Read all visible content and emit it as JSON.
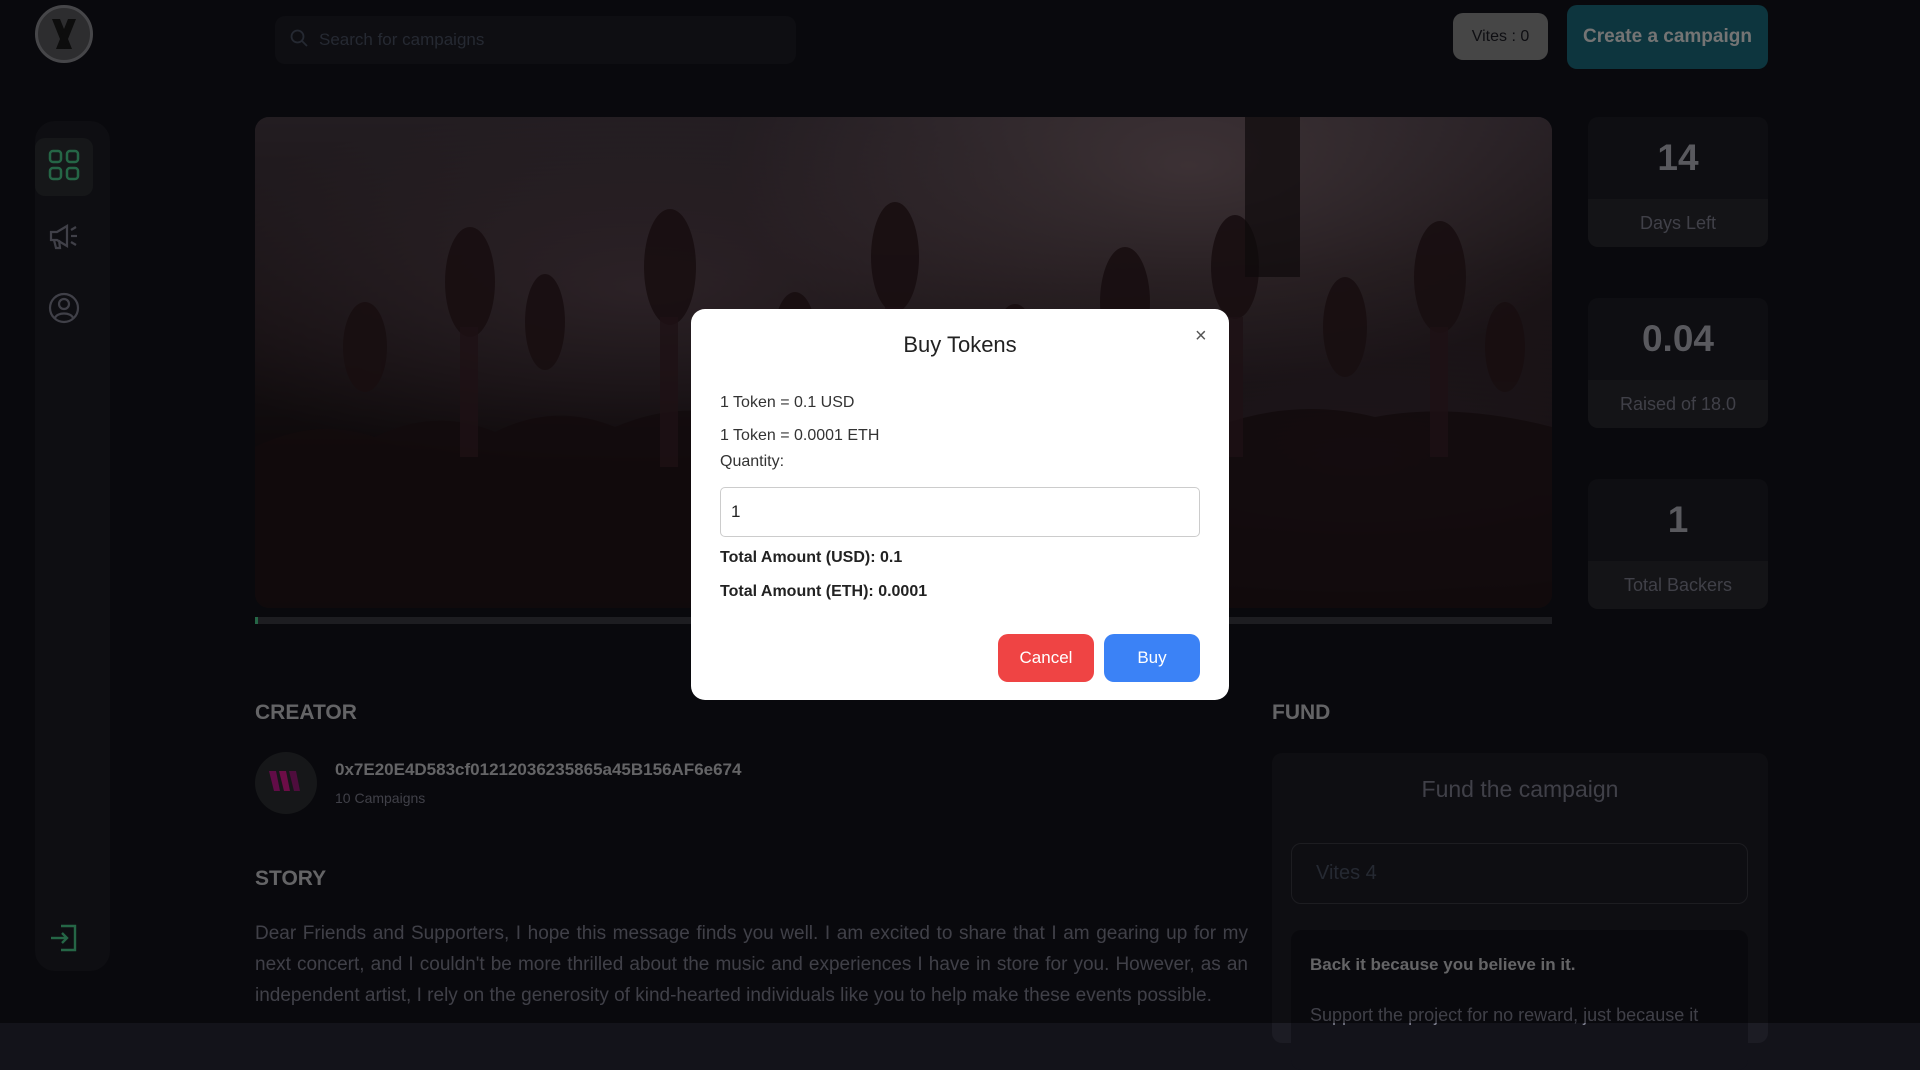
{
  "header": {
    "search_placeholder": "Search for campaigns",
    "vites_label": "Vites : 0",
    "create_label": "Create a campaign"
  },
  "campaign": {
    "progress_fraction": 0.002
  },
  "stats": [
    {
      "value": "14",
      "label": "Days Left"
    },
    {
      "value": "0.04",
      "label": "Raised of 18.0"
    },
    {
      "value": "1",
      "label": "Total Backers"
    }
  ],
  "creator": {
    "section_title": "CREATOR",
    "address": "0x7E20E4D583cf01212036235865a45B156AF6e674",
    "campaigns": "10 Campaigns"
  },
  "story": {
    "section_title": "STORY",
    "text": "Dear Friends and Supporters, I hope this message finds you well. I am excited to share that I am gearing up for my next concert, and I couldn't be more thrilled about the music and experiences I have in store for you. However, as an independent artist, I rely on the generosity of kind-hearted individuals like you to help make these events possible."
  },
  "fund": {
    "section_title": "FUND",
    "box_title": "Fund the campaign",
    "input_placeholder": "Vites 4",
    "card_title": "Back it because you believe in it.",
    "card_text": "Support the project for no reward, just because it"
  },
  "modal": {
    "title": "Buy Tokens",
    "close": "×",
    "rate_usd": "1 Token = 0.1 USD",
    "rate_eth": "1 Token = 0.0001 ETH",
    "quantity_label": "Quantity:",
    "quantity_value": "1",
    "total_usd": "Total Amount (USD): 0.1",
    "total_eth": "Total Amount (ETH): 0.0001",
    "cancel_label": "Cancel",
    "buy_label": "Buy"
  },
  "colors": {
    "accent": "#4acd8d",
    "create_button": "#1b6b7c",
    "cancel": "#ef4444",
    "buy": "#3b82f6"
  },
  "icons": {
    "logo": "logo-icon",
    "search": "search-icon",
    "dashboard": "dashboard-icon",
    "campaign": "megaphone-icon",
    "profile": "profile-icon",
    "logout": "logout-icon",
    "close": "close-icon"
  }
}
